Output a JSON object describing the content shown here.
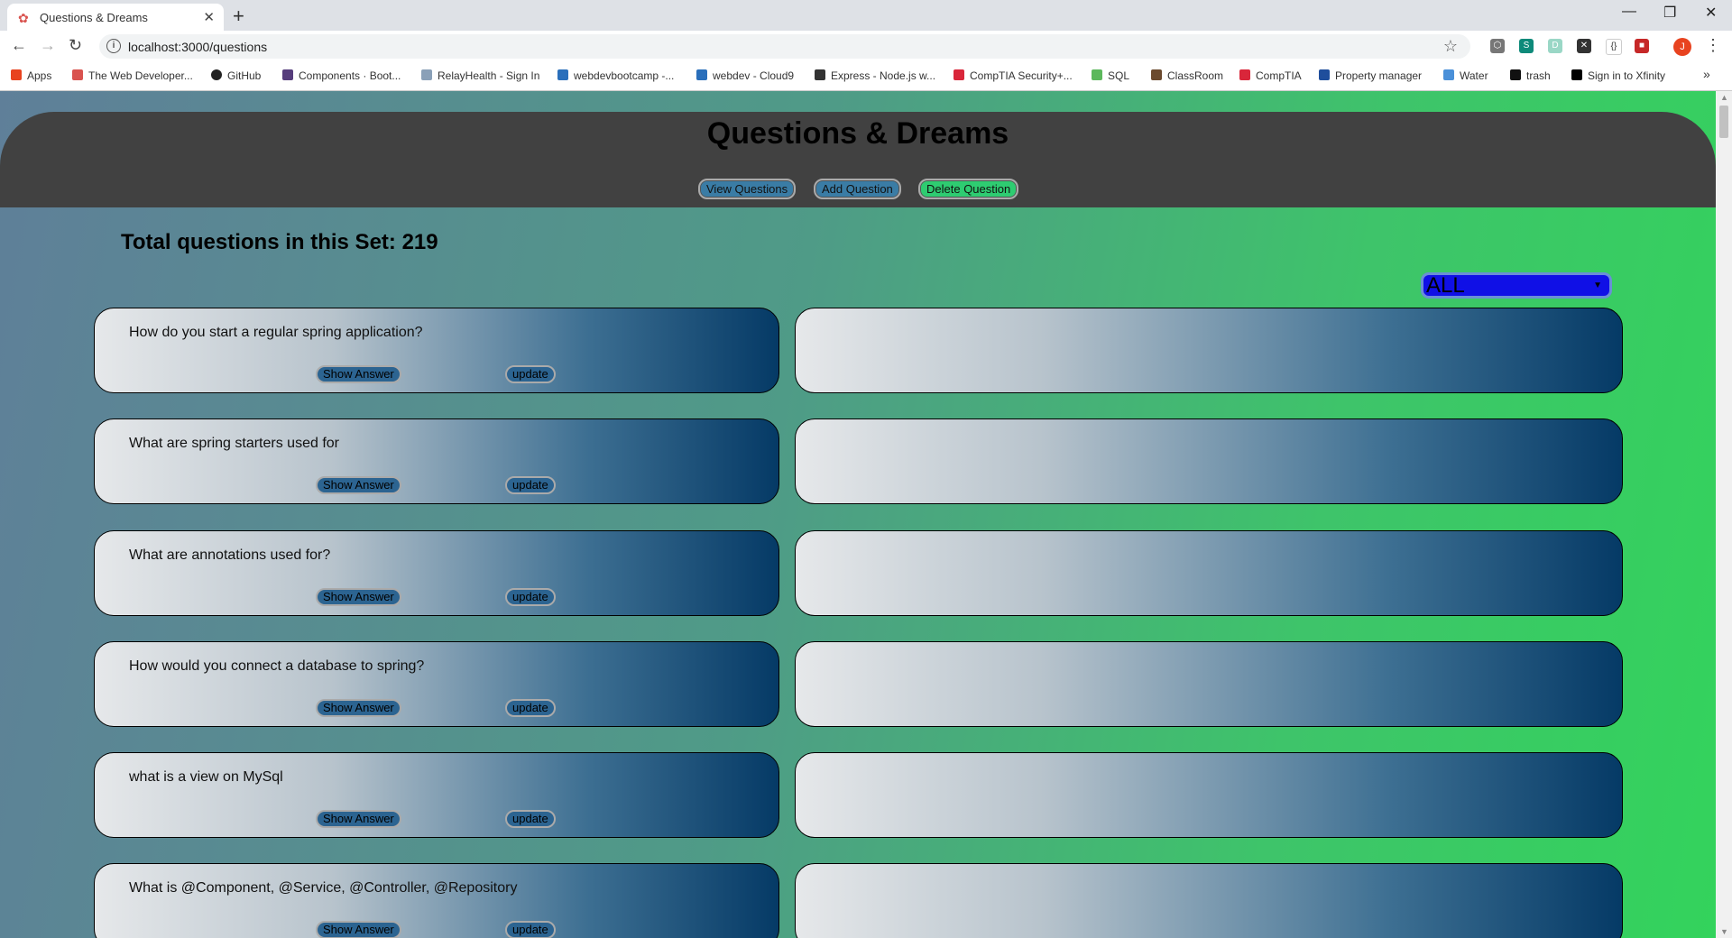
{
  "browser": {
    "tab_title": "Questions & Dreams",
    "url": "localhost:3000/questions",
    "profile_initial": "J",
    "bookmarks": [
      {
        "label": "Apps",
        "icon": "apps-grid-icon",
        "color": "#e8431f"
      },
      {
        "label": "The Web Developer...",
        "icon": "udemy-icon",
        "color": "#d9534f"
      },
      {
        "label": "GitHub",
        "icon": "github-icon",
        "color": "#222222"
      },
      {
        "label": "Components · Boot...",
        "icon": "bootstrap-icon",
        "color": "#563d7c"
      },
      {
        "label": "RelayHealth - Sign In",
        "icon": "relayhealth-icon",
        "color": "#8aa0b8"
      },
      {
        "label": "webdevbootcamp -...",
        "icon": "cloud9-icon",
        "color": "#2a6fbb"
      },
      {
        "label": "webdev - Cloud9",
        "icon": "cloud9-icon",
        "color": "#2a6fbb"
      },
      {
        "label": "Express - Node.js w...",
        "icon": "express-icon",
        "color": "#333333"
      },
      {
        "label": "CompTIA Security+...",
        "icon": "comptia-icon",
        "color": "#d9263a"
      },
      {
        "label": "SQL",
        "icon": "sql-icon",
        "color": "#5cb85c"
      },
      {
        "label": "ClassRoom",
        "icon": "classroom-icon",
        "color": "#6b4a2e"
      },
      {
        "label": "CompTIA",
        "icon": "comptia-icon",
        "color": "#d9263a"
      },
      {
        "label": "Property manager",
        "icon": "property-icon",
        "color": "#1f4e9c"
      },
      {
        "label": "Water",
        "icon": "water-icon",
        "color": "#4a90d9"
      },
      {
        "label": "trash",
        "icon": "hb-icon",
        "color": "#111111"
      },
      {
        "label": "Sign in to Xfinity",
        "icon": "xfinity-icon",
        "color": "#000000"
      }
    ]
  },
  "header": {
    "title": "Questions & Dreams",
    "nav": [
      "View Questions",
      "Add Question",
      "Delete Question"
    ]
  },
  "total_text": "Total questions in this Set: 219",
  "filter": {
    "selected": "ALL"
  },
  "questions": [
    {
      "text": "How do you start a regular spring application?",
      "show_label": "Show Answer",
      "update_label": "update"
    },
    {
      "text": "What are spring starters used for",
      "show_label": "Show Answer",
      "update_label": "update"
    },
    {
      "text": "What are annotations used for?",
      "show_label": "Show Answer",
      "update_label": "update"
    },
    {
      "text": "How would you connect a database to spring?",
      "show_label": "Show Answer",
      "update_label": "update"
    },
    {
      "text": "what is a view on MySql",
      "show_label": "Show Answer",
      "update_label": "update"
    },
    {
      "text": "What is @Component, @Service, @Controller, @Repository",
      "show_label": "Show Answer",
      "update_label": "update"
    }
  ]
}
